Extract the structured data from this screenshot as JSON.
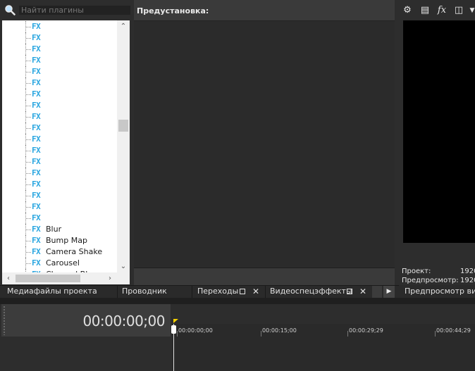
{
  "search": {
    "placeholder": "Найти плагины"
  },
  "tree": {
    "fx_badge": "FX",
    "items": [
      {
        "label": ""
      },
      {
        "label": ""
      },
      {
        "label": ""
      },
      {
        "label": ""
      },
      {
        "label": ""
      },
      {
        "label": ""
      },
      {
        "label": ""
      },
      {
        "label": ""
      },
      {
        "label": ""
      },
      {
        "label": ""
      },
      {
        "label": ""
      },
      {
        "label": ""
      },
      {
        "label": ""
      },
      {
        "label": ""
      },
      {
        "label": ""
      },
      {
        "label": ""
      },
      {
        "label": ""
      },
      {
        "label": ""
      },
      {
        "label": "Blur"
      },
      {
        "label": "Bump Map"
      },
      {
        "label": "Camera Shake"
      },
      {
        "label": "Carousel"
      },
      {
        "label": "Channel Bl..."
      }
    ]
  },
  "preset": {
    "title": "Предустановка:"
  },
  "preview": {
    "info": [
      {
        "label": "Проект:",
        "value": "1920"
      },
      {
        "label": "Предпросмотр:",
        "value": "1920"
      }
    ],
    "bottom_tab": "Предпросмотр виде"
  },
  "tabs": [
    {
      "label": "Медиафайлы проекта"
    },
    {
      "label": "Проводник"
    },
    {
      "label": "Переходы"
    },
    {
      "label": "Видеоспецэффекты"
    }
  ],
  "timeline": {
    "timecode": "00:00:00;00",
    "ruler_labels": [
      "00:00:00;00",
      "00:00:15;00",
      "00:00:29;29",
      "00:00:44;29"
    ]
  },
  "colors": {
    "fx_badge": "#2aa6e0",
    "marker": "#f5d000",
    "preview_bg": "#000000"
  }
}
